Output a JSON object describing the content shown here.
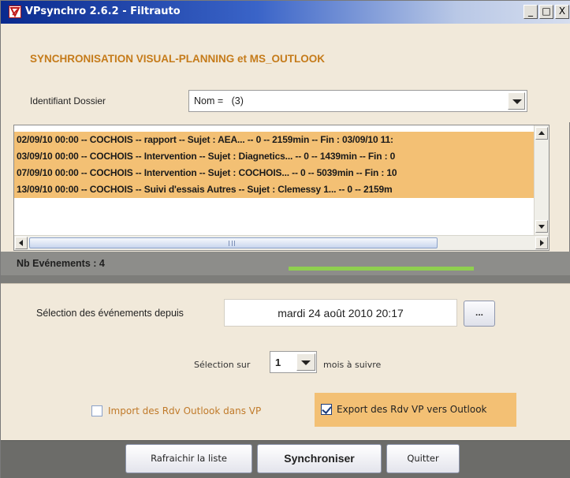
{
  "window": {
    "title": "VPsynchro 2.6.2 - Filtrauto",
    "controls": {
      "minimize": "_",
      "maximize": "□",
      "close": "X"
    }
  },
  "header": {
    "heading": "SYNCHRONISATION VISUAL-PLANNING et MS_OUTLOOK",
    "folder_label": "Identifiant Dossier",
    "folder_value": "Nom =   (3)"
  },
  "events": {
    "rows": [
      "02/09/10 00:00 -- COCHOIS -- rapport -- Sujet : AEA... -- 0 -- 2159min -- Fin : 03/09/10 11:",
      "03/09/10 00:00 -- COCHOIS -- Intervention -- Sujet : Diagnetics... -- 0 -- 1439min -- Fin : 0",
      "07/09/10 00:00 -- COCHOIS -- Intervention -- Sujet : COCHOIS... -- 0 -- 5039min -- Fin : 10",
      "13/09/10 00:00 -- COCHOIS -- Suivi d'essais Autres -- Sujet : Clemessy 1... -- 0 -- 2159m"
    ]
  },
  "count": {
    "label": "Nb Evénements : ",
    "value": "4"
  },
  "selection": {
    "since_label": "Sélection des événements depuis",
    "date_value": "mardi 24 août 2010  20:17",
    "ellipsis_label": "...",
    "months_left": "Sélection sur",
    "months_value": "1",
    "months_right": "mois à suivre"
  },
  "options": {
    "import_label": "Import des Rdv Outlook dans VP",
    "import_checked": false,
    "export_label": "Export des Rdv VP vers Outlook",
    "export_checked": true
  },
  "buttons": {
    "refresh": "Rafraichir la liste",
    "sync": "Synchroniser",
    "quit": "Quitter"
  },
  "colors": {
    "accent_orange": "#f3c074",
    "heading_color": "#c57b1a",
    "progress_green": "#8fcf4f",
    "titlebar_blue": "#0a2a8e"
  },
  "icons": {
    "app_logo": "vpsynchro-logo-icon",
    "dropdown": "chevron-down-icon"
  }
}
